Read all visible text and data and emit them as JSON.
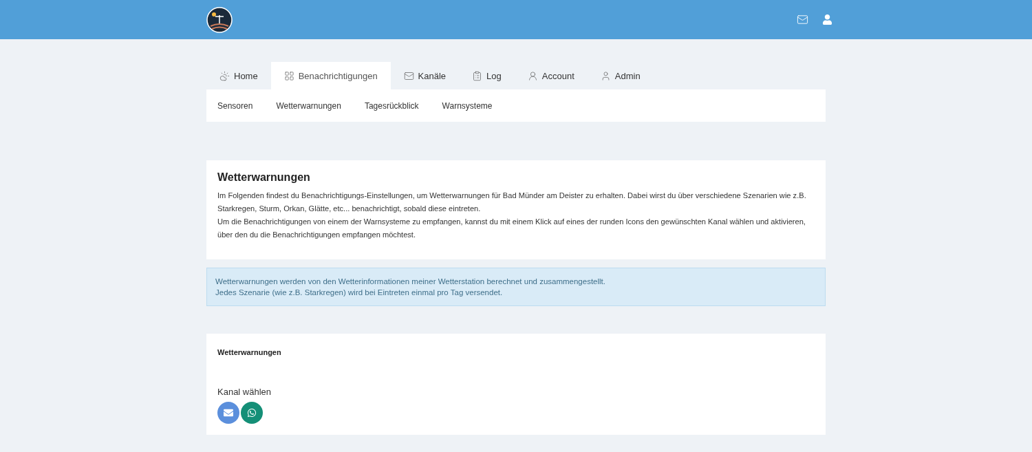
{
  "tabs": [
    {
      "label": "Home",
      "kind": "home",
      "selected": false
    },
    {
      "label": "Benachrichtigungen",
      "kind": "notifications",
      "selected": true
    },
    {
      "label": "Kanäle",
      "kind": "channels",
      "selected": false
    },
    {
      "label": "Log",
      "kind": "log",
      "selected": false
    },
    {
      "label": "Account",
      "kind": "account",
      "selected": false
    },
    {
      "label": "Admin",
      "kind": "admin",
      "selected": false
    }
  ],
  "subnav": [
    "Sensoren",
    "Wetterwarnungen",
    "Tagesrückblick",
    "Warnsysteme"
  ],
  "intro": {
    "title": "Wetterwarnungen",
    "paragraphs": [
      "Im Folgenden findest du Benachrichtigungs-Einstellungen, um Wetterwarnungen für Bad Münder am Deister zu erhalten. Dabei wirst du über verschiedene Szenarien wie z.B. Starkregen, Sturm, Orkan, Glätte, etc... benachrichtigt, sobald diese eintreten.",
      "Um die Benachrichtigungen von einem der Warnsysteme zu empfangen, kannst du mit einem Klick auf eines der runden Icons den gewünschten Kanal wählen und aktivieren, über den du die Benachrichtigungen empfangen möchtest."
    ]
  },
  "alert": [
    "Wetterwarnungen werden von den Wetterinformationen meiner Wetterstation berechnet und zusammengestellt.",
    "Jedes Szenarie (wie z.B. Starkregen) wird bei Eintreten einmal pro Tag versendet."
  ],
  "settings": {
    "title": "Wetterwarnungen",
    "channel_label": "Kanal wählen",
    "channels": [
      {
        "kind": "email",
        "color": "#5b8fdc"
      },
      {
        "kind": "whatsapp",
        "color": "#148f77"
      }
    ]
  }
}
